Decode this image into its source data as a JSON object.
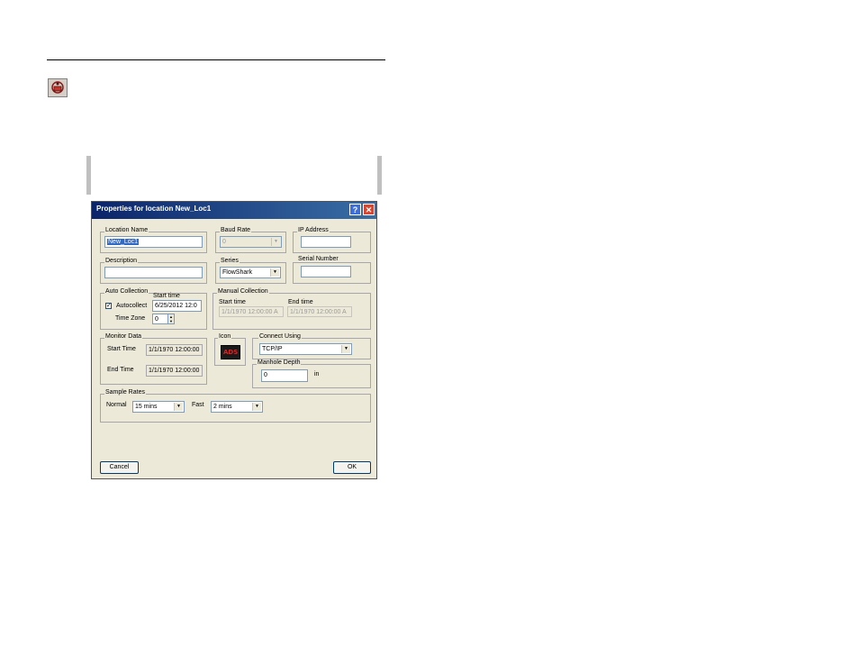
{
  "dialog": {
    "title": "Properties for location New_Loc1",
    "help_symbol": "?",
    "close_symbol": "✕"
  },
  "location_name": {
    "label": "Location Name",
    "value": "New_Loc1"
  },
  "baud_rate": {
    "label": "Baud Rate",
    "value": "0"
  },
  "ip_address": {
    "label": "IP Address",
    "value": ""
  },
  "description": {
    "label": "Description",
    "value": ""
  },
  "series": {
    "label": "Series",
    "value": "FlowShark"
  },
  "serial_number": {
    "label": "Serial Number",
    "value": ""
  },
  "auto_collection": {
    "label": "Auto Collection",
    "start_time_label": "Start time",
    "autocollect_label": "Autocollect",
    "autocollect_checked": true,
    "start_time_value": "6/25/2012 12:0",
    "time_zone_label": "Time Zone",
    "time_zone_value": "0"
  },
  "manual_collection": {
    "label": "Manual Collection",
    "start_time_label": "Start time",
    "end_time_label": "End time",
    "start_time_value": "1/1/1970 12:00:00 A",
    "end_time_value": "1/1/1970 12:00:00 A"
  },
  "monitor_data": {
    "label": "Monitor Data",
    "start_time_label": "Start Time",
    "start_time_value": "1/1/1970 12:00:00",
    "end_time_label": "End Time",
    "end_time_value": "1/1/1970 12:00:00"
  },
  "icon_group": {
    "label": "Icon",
    "icon_name": "ads-monitor-icon",
    "icon_text": "ADS"
  },
  "connect_using": {
    "label": "Connect Using",
    "value": "TCP/IP"
  },
  "manhole_depth": {
    "label": "Manhole Depth",
    "value": "0",
    "unit": "in"
  },
  "sample_rates": {
    "label": "Sample Rates",
    "normal_label": "Normal",
    "normal_value": "15 mins",
    "fast_label": "Fast",
    "fast_value": "2 mins"
  },
  "buttons": {
    "cancel": "Cancel",
    "ok": "OK"
  },
  "colors": {
    "titlebar_start": "#0a246a",
    "titlebar_end": "#3a6ea5",
    "dialog_bg": "#ece9d8"
  }
}
